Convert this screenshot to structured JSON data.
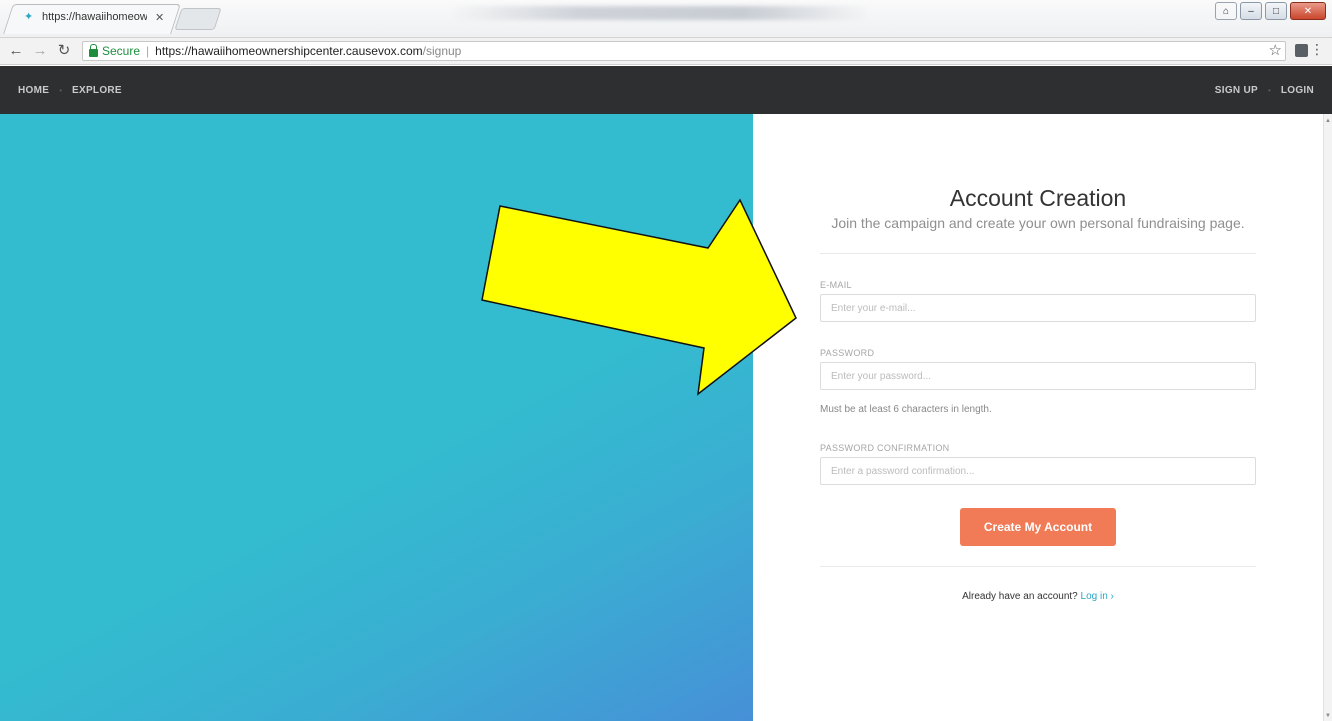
{
  "browser": {
    "tab_title": "https://hawaiihomeowne",
    "tab_close": "✕",
    "secure_label": "Secure",
    "url_host": "https://hawaiihomeownershipcenter.causevox.com",
    "url_path": "/signup"
  },
  "site_nav": {
    "left": [
      {
        "label": "HOME"
      },
      {
        "label": "EXPLORE"
      }
    ],
    "right": [
      {
        "label": "SIGN UP"
      },
      {
        "label": "LOGIN"
      }
    ]
  },
  "form": {
    "title": "Account Creation",
    "subtitle": "Join the campaign and create your own personal fundraising page.",
    "email_label": "E-MAIL",
    "email_placeholder": "Enter your e-mail...",
    "email_value": "",
    "password_label": "PASSWORD",
    "password_placeholder": "Enter your password...",
    "password_value": "",
    "password_hint": "Must be at least 6 characters in length.",
    "confirm_label": "PASSWORD CONFIRMATION",
    "confirm_placeholder": "Enter a password confirmation...",
    "confirm_value": "",
    "submit_label": "Create My Account",
    "already_text": "Already have an account?",
    "login_link": "Log in ›"
  },
  "colors": {
    "hero_teal": "#33bccf",
    "hero_blue": "#4690d7",
    "button_orange": "#f07b56",
    "link_blue": "#2aa6c8",
    "nav_bg": "#2e2f31",
    "arrow_yellow": "#ffff00"
  }
}
